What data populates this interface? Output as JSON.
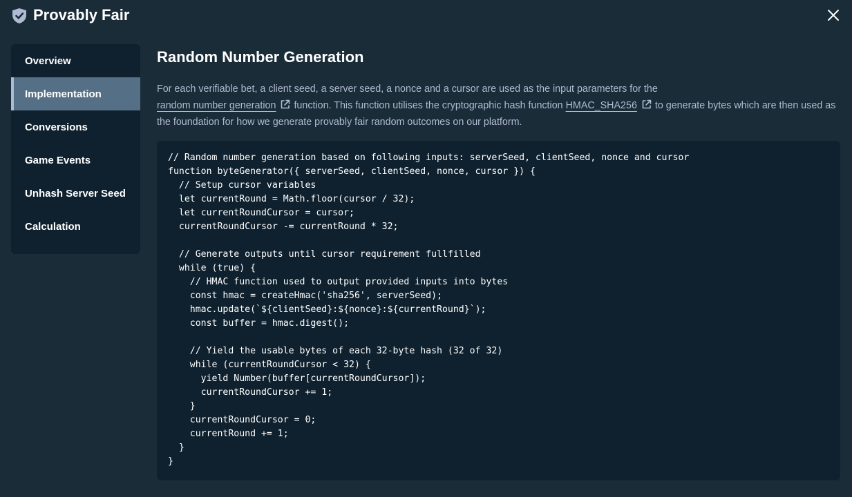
{
  "header": {
    "title": "Provably Fair",
    "icon": "shield-check-icon",
    "close_icon": "close-icon"
  },
  "sidebar": {
    "items": [
      {
        "label": "Overview",
        "active": false
      },
      {
        "label": "Implementation",
        "active": true
      },
      {
        "label": "Conversions",
        "active": false
      },
      {
        "label": "Game Events",
        "active": false
      },
      {
        "label": "Unhash Server Seed",
        "active": false
      },
      {
        "label": "Calculation",
        "active": false
      }
    ]
  },
  "main": {
    "title": "Random Number Generation",
    "desc": {
      "part1": "For each verifiable bet, a client seed, a server seed, a nonce and a cursor are used as the input parameters for the",
      "link1": "random number generation",
      "part2": "function. This function utilises the cryptographic hash function",
      "link2": "HMAC_SHA256",
      "part3": "to generate bytes which are then used as the foundation for how we generate provably fair random outcomes on our platform."
    },
    "code": [
      "// Random number generation based on following inputs: serverSeed, clientSeed, nonce and cursor",
      "function byteGenerator({ serverSeed, clientSeed, nonce, cursor }) {",
      "  // Setup cursor variables",
      "  let currentRound = Math.floor(cursor / 32);",
      "  let currentRoundCursor = cursor;",
      "  currentRoundCursor -= currentRound * 32;",
      "",
      "  // Generate outputs until cursor requirement fullfilled",
      "  while (true) {",
      "    // HMAC function used to output provided inputs into bytes",
      "    const hmac = createHmac('sha256', serverSeed);",
      "    hmac.update(`${clientSeed}:${nonce}:${currentRound}`);",
      "    const buffer = hmac.digest();",
      "",
      "    // Yield the usable bytes of each 32-byte hash (32 of 32)",
      "    while (currentRoundCursor < 32) {",
      "      yield Number(buffer[currentRoundCursor]);",
      "      currentRoundCursor += 1;",
      "    }",
      "    currentRoundCursor = 0;",
      "    currentRound += 1;",
      "  }",
      "}"
    ]
  },
  "colors": {
    "background": "#1a2c38",
    "panel": "#0f212e",
    "active": "#557086",
    "muted_text": "#b1bad3"
  }
}
